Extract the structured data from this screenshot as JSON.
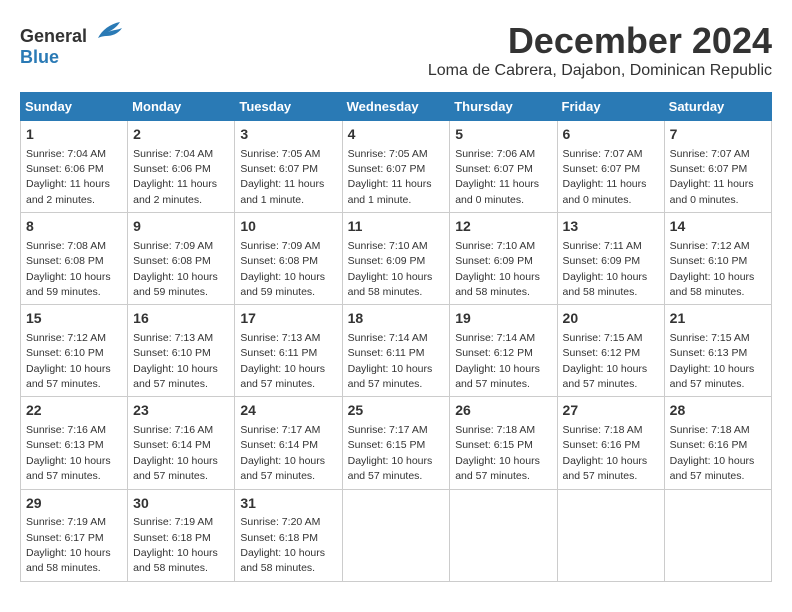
{
  "header": {
    "logo_general": "General",
    "logo_blue": "Blue",
    "month_title": "December 2024",
    "location": "Loma de Cabrera, Dajabon, Dominican Republic"
  },
  "weekdays": [
    "Sunday",
    "Monday",
    "Tuesday",
    "Wednesday",
    "Thursday",
    "Friday",
    "Saturday"
  ],
  "weeks": [
    [
      {
        "day": "1",
        "sunrise": "7:04 AM",
        "sunset": "6:06 PM",
        "daylight": "11 hours and 2 minutes."
      },
      {
        "day": "2",
        "sunrise": "7:04 AM",
        "sunset": "6:06 PM",
        "daylight": "11 hours and 2 minutes."
      },
      {
        "day": "3",
        "sunrise": "7:05 AM",
        "sunset": "6:07 PM",
        "daylight": "11 hours and 1 minute."
      },
      {
        "day": "4",
        "sunrise": "7:05 AM",
        "sunset": "6:07 PM",
        "daylight": "11 hours and 1 minute."
      },
      {
        "day": "5",
        "sunrise": "7:06 AM",
        "sunset": "6:07 PM",
        "daylight": "11 hours and 0 minutes."
      },
      {
        "day": "6",
        "sunrise": "7:07 AM",
        "sunset": "6:07 PM",
        "daylight": "11 hours and 0 minutes."
      },
      {
        "day": "7",
        "sunrise": "7:07 AM",
        "sunset": "6:07 PM",
        "daylight": "11 hours and 0 minutes."
      }
    ],
    [
      {
        "day": "8",
        "sunrise": "7:08 AM",
        "sunset": "6:08 PM",
        "daylight": "10 hours and 59 minutes."
      },
      {
        "day": "9",
        "sunrise": "7:09 AM",
        "sunset": "6:08 PM",
        "daylight": "10 hours and 59 minutes."
      },
      {
        "day": "10",
        "sunrise": "7:09 AM",
        "sunset": "6:08 PM",
        "daylight": "10 hours and 59 minutes."
      },
      {
        "day": "11",
        "sunrise": "7:10 AM",
        "sunset": "6:09 PM",
        "daylight": "10 hours and 58 minutes."
      },
      {
        "day": "12",
        "sunrise": "7:10 AM",
        "sunset": "6:09 PM",
        "daylight": "10 hours and 58 minutes."
      },
      {
        "day": "13",
        "sunrise": "7:11 AM",
        "sunset": "6:09 PM",
        "daylight": "10 hours and 58 minutes."
      },
      {
        "day": "14",
        "sunrise": "7:12 AM",
        "sunset": "6:10 PM",
        "daylight": "10 hours and 58 minutes."
      }
    ],
    [
      {
        "day": "15",
        "sunrise": "7:12 AM",
        "sunset": "6:10 PM",
        "daylight": "10 hours and 57 minutes."
      },
      {
        "day": "16",
        "sunrise": "7:13 AM",
        "sunset": "6:10 PM",
        "daylight": "10 hours and 57 minutes."
      },
      {
        "day": "17",
        "sunrise": "7:13 AM",
        "sunset": "6:11 PM",
        "daylight": "10 hours and 57 minutes."
      },
      {
        "day": "18",
        "sunrise": "7:14 AM",
        "sunset": "6:11 PM",
        "daylight": "10 hours and 57 minutes."
      },
      {
        "day": "19",
        "sunrise": "7:14 AM",
        "sunset": "6:12 PM",
        "daylight": "10 hours and 57 minutes."
      },
      {
        "day": "20",
        "sunrise": "7:15 AM",
        "sunset": "6:12 PM",
        "daylight": "10 hours and 57 minutes."
      },
      {
        "day": "21",
        "sunrise": "7:15 AM",
        "sunset": "6:13 PM",
        "daylight": "10 hours and 57 minutes."
      }
    ],
    [
      {
        "day": "22",
        "sunrise": "7:16 AM",
        "sunset": "6:13 PM",
        "daylight": "10 hours and 57 minutes."
      },
      {
        "day": "23",
        "sunrise": "7:16 AM",
        "sunset": "6:14 PM",
        "daylight": "10 hours and 57 minutes."
      },
      {
        "day": "24",
        "sunrise": "7:17 AM",
        "sunset": "6:14 PM",
        "daylight": "10 hours and 57 minutes."
      },
      {
        "day": "25",
        "sunrise": "7:17 AM",
        "sunset": "6:15 PM",
        "daylight": "10 hours and 57 minutes."
      },
      {
        "day": "26",
        "sunrise": "7:18 AM",
        "sunset": "6:15 PM",
        "daylight": "10 hours and 57 minutes."
      },
      {
        "day": "27",
        "sunrise": "7:18 AM",
        "sunset": "6:16 PM",
        "daylight": "10 hours and 57 minutes."
      },
      {
        "day": "28",
        "sunrise": "7:18 AM",
        "sunset": "6:16 PM",
        "daylight": "10 hours and 57 minutes."
      }
    ],
    [
      {
        "day": "29",
        "sunrise": "7:19 AM",
        "sunset": "6:17 PM",
        "daylight": "10 hours and 58 minutes."
      },
      {
        "day": "30",
        "sunrise": "7:19 AM",
        "sunset": "6:18 PM",
        "daylight": "10 hours and 58 minutes."
      },
      {
        "day": "31",
        "sunrise": "7:20 AM",
        "sunset": "6:18 PM",
        "daylight": "10 hours and 58 minutes."
      },
      null,
      null,
      null,
      null
    ]
  ]
}
